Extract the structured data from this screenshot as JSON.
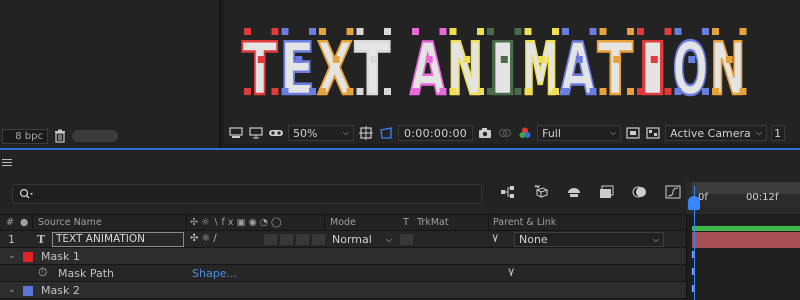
{
  "project": {
    "bit_depth": "8 bpc"
  },
  "viewer": {
    "comp_text": "TEXT ANIMATION",
    "letter_colors": [
      "#e03a3a",
      "#6a7de0",
      "#e8a23a",
      "#d8d8d8",
      "#e86ad8",
      "#f0e050",
      "#4a6a4a",
      "#f0e050",
      "#6a7de0",
      "#e8a23a"
    ]
  },
  "toolbar": {
    "zoom": "50%",
    "timecode": "0:00:00:00",
    "resolution": "Full",
    "camera": "Active Camera",
    "views": "1"
  },
  "search": {
    "placeholder": "",
    "icon": "search-icon"
  },
  "columns": {
    "number": "#",
    "source_name": "Source Name",
    "mode": "Mode",
    "t": "T",
    "trkmat": "TrkMat",
    "parent": "Parent & Link"
  },
  "layers": {
    "layer1": {
      "index": "1",
      "type_icon": "T",
      "name": "TEXT ANIMATION",
      "mode": "Normal",
      "parent": "None"
    },
    "mask1": {
      "name": "Mask 1",
      "color": "#e32222"
    },
    "mask_path": {
      "name": "Mask Path",
      "value": "Shape..."
    },
    "mask2": {
      "name": "Mask 2",
      "color": "#5a74d8"
    }
  },
  "timeline": {
    "ruler_start": "0f",
    "ruler_12": "00:12f",
    "layer_bar_color": "#a84f55",
    "work_area_color": "#3fb84a"
  }
}
